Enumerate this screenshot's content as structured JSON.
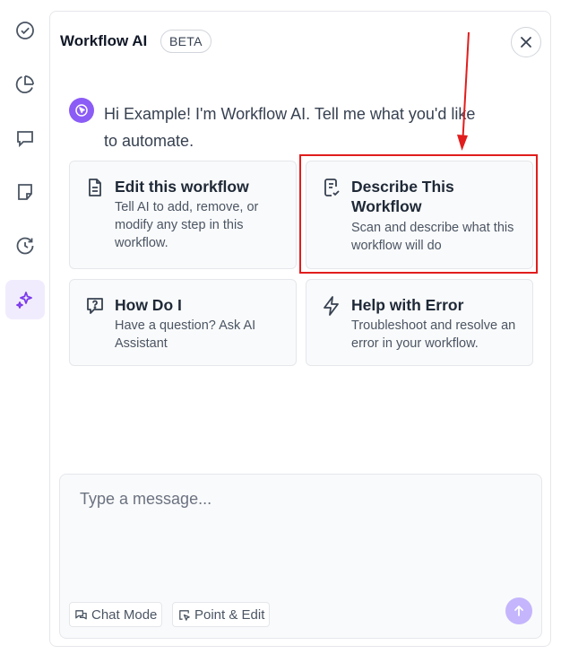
{
  "rail": {
    "items": [
      {
        "icon": "check-circle-icon"
      },
      {
        "icon": "pie-chart-icon"
      },
      {
        "icon": "chat-bubble-icon"
      },
      {
        "icon": "sticky-note-icon"
      },
      {
        "icon": "history-icon"
      },
      {
        "icon": "sparkles-icon",
        "active": true
      }
    ]
  },
  "header": {
    "title": "Workflow AI",
    "badge": "BETA"
  },
  "greeting": {
    "text": "Hi Example! I'm Workflow AI. Tell me what you'd like to automate."
  },
  "cards": [
    {
      "icon": "document-icon",
      "title": "Edit this workflow",
      "description": "Tell AI to add, remove, or modify any step in this workflow."
    },
    {
      "icon": "checklist-document-icon",
      "title": "Describe This Workflow",
      "description": "Scan and describe what this workflow will do"
    },
    {
      "icon": "question-bubble-icon",
      "title": "How Do I",
      "description": "Have a question? Ask AI Assistant"
    },
    {
      "icon": "lightning-icon",
      "title": "Help with Error",
      "description": "Troubleshoot and resolve an error in your workflow."
    }
  ],
  "composer": {
    "placeholder": "Type a message...",
    "chat_mode_label": "Chat Mode",
    "point_edit_label": "Point & Edit"
  },
  "colors": {
    "accent": "#8b5cf6",
    "annotation": "#e11d1d"
  }
}
